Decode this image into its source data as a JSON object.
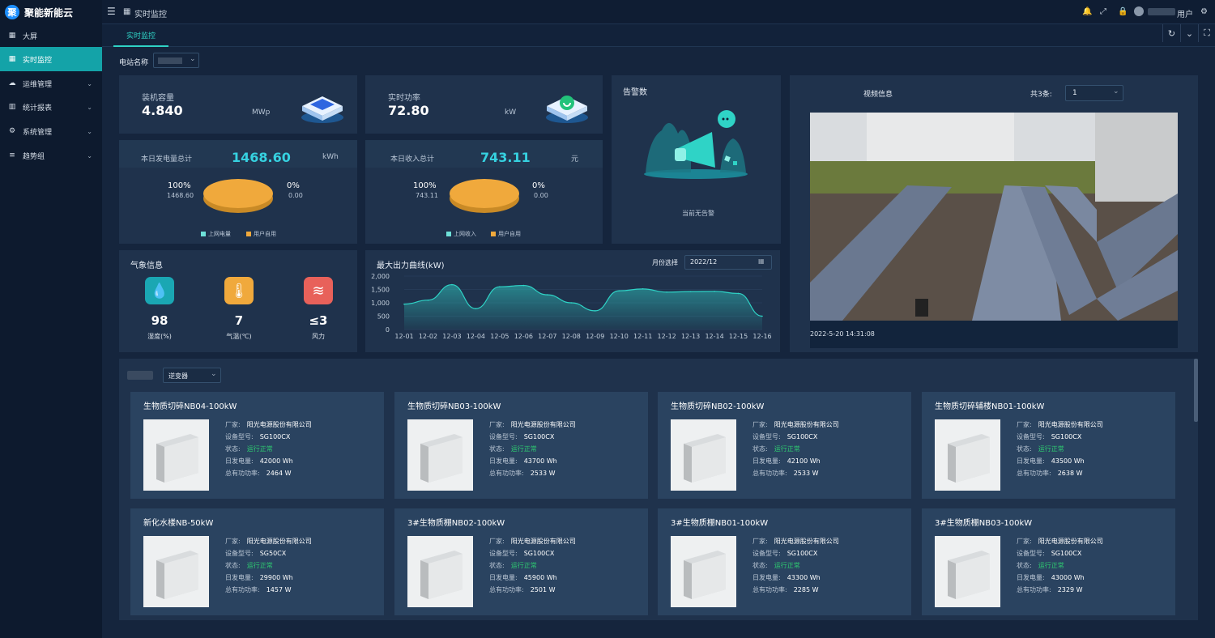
{
  "app": {
    "name": "聚能新能云",
    "logo_letter": "聚"
  },
  "sidebar": {
    "items": [
      {
        "label": "大屏",
        "icon": "▦",
        "active": false,
        "expand": false
      },
      {
        "label": "实时监控",
        "icon": "▦",
        "active": true,
        "expand": false
      },
      {
        "label": "运维管理",
        "icon": "☁",
        "active": false,
        "expand": true
      },
      {
        "label": "统计报表",
        "icon": "▥",
        "active": false,
        "expand": true
      },
      {
        "label": "系统管理",
        "icon": "⚙",
        "active": false,
        "expand": true
      },
      {
        "label": "趋势组",
        "icon": "≡",
        "active": false,
        "expand": true
      }
    ]
  },
  "topbar": {
    "menu_icon": "☰",
    "page_icon": "▦",
    "breadcrumb": "实时监控",
    "user": "用户"
  },
  "tabs": [
    {
      "label": "实时监控"
    }
  ],
  "station": {
    "label": "电站名称"
  },
  "capacity": {
    "label": "装机容量",
    "value": "4.840",
    "unit": "MWp"
  },
  "power": {
    "label": "实时功率",
    "value": "72.80",
    "unit": "kW"
  },
  "alarm": {
    "title": "告警数",
    "empty": "当前无告警"
  },
  "video": {
    "title": "视频信息",
    "count_label": "共3条:",
    "selected": "1",
    "timestamp": "2022-5-20 14:31:08"
  },
  "generation": {
    "label": "本日发电量总计",
    "value": "1468.60",
    "unit": "kWh",
    "left_pct": "100%",
    "left_val": "1468.60",
    "right_pct": "0%",
    "right_val": "0.00",
    "legend": [
      "上网电量",
      "用户自用"
    ]
  },
  "income": {
    "label": "本日收入总计",
    "value": "743.11",
    "unit": "元",
    "left_pct": "100%",
    "left_val": "743.11",
    "right_pct": "0%",
    "right_val": "0.00",
    "legend": [
      "上网收入",
      "用户自用"
    ]
  },
  "colors": {
    "teal": "#36d1e0",
    "orange": "#f0a93c",
    "legend_teal": "#6ee0d8"
  },
  "weather": {
    "title": "气象信息",
    "items": [
      {
        "value": "98",
        "label": "湿度(%)",
        "icon": "water-drop-icon",
        "glyph": "💧",
        "color": "#1aa7b3"
      },
      {
        "value": "7",
        "label": "气温(℃)",
        "icon": "thermometer-icon",
        "glyph": "🌡",
        "color": "#f0a93c"
      },
      {
        "value": "≤3",
        "label": "风力",
        "icon": "wind-icon",
        "glyph": "≋",
        "color": "#e8615a"
      }
    ]
  },
  "chart_data": {
    "type": "area",
    "title": "最大出力曲线(kW)",
    "month_label": "月份选择",
    "month_value": "2022/12",
    "categories": [
      "12-01",
      "12-02",
      "12-03",
      "12-04",
      "12-05",
      "12-06",
      "12-07",
      "12-08",
      "12-09",
      "12-10",
      "12-11",
      "12-12",
      "12-13",
      "12-14",
      "12-15",
      "12-16"
    ],
    "values": [
      950,
      1100,
      1680,
      780,
      1600,
      1650,
      1300,
      1000,
      700,
      1450,
      1520,
      1400,
      1420,
      1430,
      1350,
      500
    ],
    "ylim": [
      0,
      2000
    ],
    "yticks": [
      "2,000",
      "1,500",
      "1,000",
      "500",
      "0"
    ],
    "grid": true
  },
  "devices": {
    "filter_label": "逆变器",
    "labels": {
      "maker": "厂家:",
      "model": "设备型号:",
      "status": "状态:",
      "daily": "日发电量:",
      "power": "总有功功率:"
    },
    "items": [
      {
        "name": "生物质切碎NB04-100kW",
        "maker": "阳光电源股份有限公司",
        "model": "SG100CX",
        "status": "运行正常",
        "daily": "42000  Wh",
        "power": "2464 W"
      },
      {
        "name": "生物质切碎NB03-100kW",
        "maker": "阳光电源股份有限公司",
        "model": "SG100CX",
        "status": "运行正常",
        "daily": "43700  Wh",
        "power": "2533 W"
      },
      {
        "name": "生物质切碎NB02-100kW",
        "maker": "阳光电源股份有限公司",
        "model": "SG100CX",
        "status": "运行正常",
        "daily": "42100  Wh",
        "power": "2533 W"
      },
      {
        "name": "生物质切碎辅楼NB01-100kW",
        "maker": "阳光电源股份有限公司",
        "model": "SG100CX",
        "status": "运行正常",
        "daily": "43500  Wh",
        "power": "2638 W"
      },
      {
        "name": "新化水楼NB-50kW",
        "maker": "阳光电源股份有限公司",
        "model": "SG50CX",
        "status": "运行正常",
        "daily": "29900  Wh",
        "power": "1457 W"
      },
      {
        "name": "3#生物质棚NB02-100kW",
        "maker": "阳光电源股份有限公司",
        "model": "SG100CX",
        "status": "运行正常",
        "daily": "45900  Wh",
        "power": "2501 W"
      },
      {
        "name": "3#生物质棚NB01-100kW",
        "maker": "阳光电源股份有限公司",
        "model": "SG100CX",
        "status": "运行正常",
        "daily": "43300  Wh",
        "power": "2285 W"
      },
      {
        "name": "3#生物质棚NB03-100kW",
        "maker": "阳光电源股份有限公司",
        "model": "SG100CX",
        "status": "运行正常",
        "daily": "43000  Wh",
        "power": "2329 W"
      }
    ]
  }
}
